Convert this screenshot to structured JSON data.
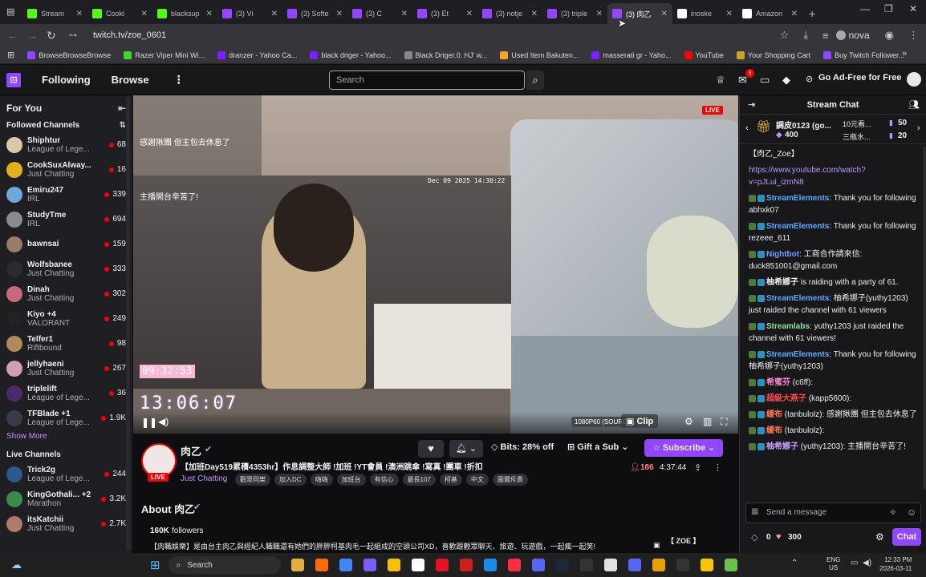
{
  "browser": {
    "tabs": [
      {
        "title": "Stream",
        "icon": "kick-icon",
        "color": "#53fc18"
      },
      {
        "title": "Cooki",
        "icon": "kick-icon",
        "color": "#53fc18"
      },
      {
        "title": "blacksup",
        "icon": "kick-icon",
        "color": "#53fc18"
      },
      {
        "title": "(3) Vi",
        "icon": "twitch-icon",
        "color": "#9146ff"
      },
      {
        "title": "(3) Softe",
        "icon": "twitch-icon",
        "color": "#9146ff"
      },
      {
        "title": "(3) C",
        "icon": "twitch-icon",
        "color": "#9146ff"
      },
      {
        "title": "(3) Et",
        "icon": "twitch-icon",
        "color": "#9146ff"
      },
      {
        "title": "(3) notje",
        "icon": "twitch-icon",
        "color": "#9146ff"
      },
      {
        "title": "(3) triple",
        "icon": "twitch-icon",
        "color": "#9146ff"
      },
      {
        "title": "(3) 肉乙",
        "icon": "twitch-icon",
        "color": "#9146ff",
        "active": true
      },
      {
        "title": "inoske",
        "icon": "google-icon",
        "color": "#ffffff"
      },
      {
        "title": "Amazon",
        "icon": "amazon-icon",
        "color": "#ffffff"
      }
    ],
    "url": "twitch.tv/zoe_0601",
    "profile_name": "nova",
    "bookmarks": [
      {
        "label": "BrowseBrowseBrowse",
        "color": "#9146ff"
      },
      {
        "label": "Razer Viper Mini Wi...",
        "color": "#44d62c"
      },
      {
        "label": "dranzer - Yahoo Ca...",
        "color": "#7e1fff"
      },
      {
        "label": "black driger - Yahoo...",
        "color": "#7e1fff"
      },
      {
        "label": "Black Driger.0. HJ' w...",
        "color": "#888888"
      },
      {
        "label": "Used Item Bakuten...",
        "color": "#f5a623"
      },
      {
        "label": "masserati gr - Yaho...",
        "color": "#7e1fff"
      },
      {
        "label": "YouTube",
        "color": "#ff0000"
      },
      {
        "label": "Your Shopping Cart",
        "color": "#c9a227"
      },
      {
        "label": "Buy Twitch Follower...",
        "color": "#9146ff"
      }
    ]
  },
  "twitch_nav": {
    "following": "Following",
    "browse": "Browse",
    "search_placeholder": "Search",
    "notif_count": "3",
    "ad_free": "Go Ad-Free for Free"
  },
  "sidebar": {
    "for_you": "For You",
    "followed_header": "Followed Channels",
    "followed": [
      {
        "name": "Shiphtur",
        "game": "League of Lege...",
        "viewers": "68",
        "color": "#d8c9a8"
      },
      {
        "name": "CookSuxAlway...",
        "game": "Just Chatting",
        "viewers": "16",
        "color": "#e0b020"
      },
      {
        "name": "Emiru247",
        "game": "IRL",
        "viewers": "339",
        "color": "#6ea8d8"
      },
      {
        "name": "StudyTme",
        "game": "IRL",
        "viewers": "694",
        "color": "#8a8a8a"
      },
      {
        "name": "bawnsai",
        "game": "",
        "viewers": "159",
        "color": "#9a7a6a"
      },
      {
        "name": "Wolfsbanee",
        "game": "Just Chatting",
        "viewers": "333",
        "color": "#2b2b2b"
      },
      {
        "name": "Dinah",
        "game": "Just Chatting",
        "viewers": "302",
        "color": "#c46a7a"
      },
      {
        "name": "Kiyo +4",
        "game": "VALORANT",
        "viewers": "249",
        "color": "#222222"
      },
      {
        "name": "Telfer1",
        "game": "Riftbound",
        "viewers": "98",
        "color": "#b08a5a"
      },
      {
        "name": "jellyhaeni",
        "game": "Just Chatting",
        "viewers": "267",
        "color": "#d0a0b0"
      },
      {
        "name": "triplelift",
        "game": "League of Lege...",
        "viewers": "36",
        "color": "#4a2a6a"
      },
      {
        "name": "TFBlade +1",
        "game": "League of Lege...",
        "viewers": "1.9K",
        "color": "#3a3a4a"
      }
    ],
    "show_more": "Show More",
    "live_header": "Live Channels",
    "live": [
      {
        "name": "Trick2g",
        "game": "League of Lege...",
        "viewers": "244",
        "color": "#2a5a8a"
      },
      {
        "name": "KingGothali... +2",
        "game": "Marathon",
        "viewers": "3.2K",
        "color": "#3a8a4a"
      },
      {
        "name": "itsKatchii",
        "game": "Just Chatting",
        "viewers": "2.7K",
        "color": "#b07a6a"
      }
    ]
  },
  "player": {
    "overlay_text_1": "感謝揪團 但主包去休息了",
    "overlay_text_2": "主播開台辛苦了!",
    "date_overlay": "Dec 09 2025 14:30:22",
    "clock_small": "09:32:53",
    "clock_big": "13:06:07",
    "live_badge": "LIVE",
    "quality": "1080P60 (SOURCE)",
    "clip": "Clip"
  },
  "stream_info": {
    "streamer": "肉乙",
    "title": "【加班Day519累積4353hr】作息調整大師 !加班 !YT會員 !澳洲跳傘 !寫真 !團車 !折扣",
    "category": "Just Chatting",
    "tags": [
      "觀眾同樂",
      "加入DC",
      "嗨嗨",
      "加班台",
      "有信心",
      "最長107",
      "柯基",
      "中文",
      "圖爾斥責"
    ],
    "viewers": "186",
    "uptime": "4:37:44",
    "bits": "Bits: 28% off",
    "gift": "Gift a Sub",
    "subscribe": "Subscribe",
    "about": "About 肉乙",
    "followers": "160K",
    "followers_label": "followers",
    "description": "【肉職娛樂】是由台主肉乙與經紀人職職還有她們的胖胖柯基肉毛一起組成的空頭公司XD，喜歡跟觀眾聊天、旅遊、玩遊戲，一起瘋一起笑!",
    "social": "【 ZOE 】"
  },
  "chat": {
    "header": "Stream Chat",
    "pinned_user": "調皮0123 (go...",
    "pinned_amount": "400",
    "pinned_right_1": "10元看...",
    "pinned_right_1_val": "50",
    "pinned_right_2": "三瓶水...",
    "pinned_right_2_val": "20",
    "messages": [
      {
        "user": "",
        "color": "#efeff1",
        "text": "【肉乙_Zoe】"
      },
      {
        "user": "",
        "color": "#bf94ff",
        "text": "https://www.youtube.com/watch?v=pJLui_izmN8"
      },
      {
        "user": "StreamElements",
        "color": "#5aa9ff",
        "text": ": Thank you for following abhxk07"
      },
      {
        "user": "StreamElements",
        "color": "#5aa9ff",
        "text": ": Thank you for following rezeee_611"
      },
      {
        "user": "Nightbot",
        "color": "#7b9cff",
        "text": ": 工商合作請來信: duck851001@gmail.com"
      },
      {
        "user": "柚希娜子",
        "color": "#efeff1",
        "text": " is raiding with a party of 61."
      },
      {
        "user": "StreamElements",
        "color": "#5aa9ff",
        "text": ": 柚希娜子(yuthy1203) just raided the channel with 61 viewers"
      },
      {
        "user": "Streamlabs",
        "color": "#8fe0a0",
        "text": ": yuthy1203 just raided the channel with 61 viewers!"
      },
      {
        "user": "StreamElements",
        "color": "#5aa9ff",
        "text": ": Thank you for following 柚希娜子(yuthy1203)"
      },
      {
        "user": "希蜜芬",
        "color": "#ff8ad0",
        "text": " (c6ff):"
      },
      {
        "user": "超級大燕子",
        "color": "#ff4a4a",
        "text": " (kapp5600):"
      },
      {
        "user": "緩布",
        "color": "#ff7f50",
        "text": " (tanbulolz): 感謝揪團 但主包去休息了"
      },
      {
        "user": "緩布",
        "color": "#ff7f50",
        "text": " (tanbulolz):"
      },
      {
        "user": "柚希娜子",
        "color": "#c8a2ff",
        "text": " (yuthy1203): 主播開台辛苦了!"
      }
    ],
    "placeholder": "Send a message",
    "points_0": "0",
    "points_1": "300",
    "chat_button": "Chat"
  },
  "taskbar": {
    "search": "Search",
    "lang_1": "ENG",
    "lang_2": "US",
    "time": "12:33 PM",
    "date": "2026-03-11"
  }
}
